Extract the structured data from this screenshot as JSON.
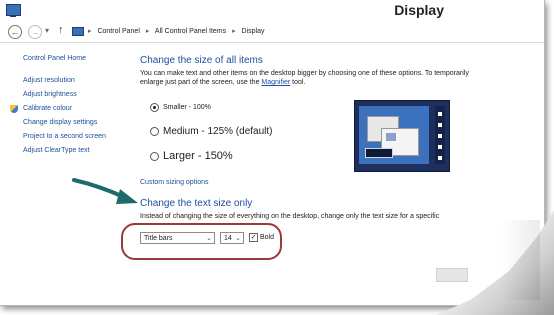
{
  "window": {
    "title": "Display"
  },
  "address": {
    "crumbs": [
      "Control Panel",
      "All Control Panel Items",
      "Display"
    ]
  },
  "sidebar": {
    "home": "Control Panel Home",
    "items": [
      {
        "label": "Adjust resolution"
      },
      {
        "label": "Adjust brightness"
      },
      {
        "label": "Calibrate colour"
      },
      {
        "label": "Change display settings"
      },
      {
        "label": "Project to a second screen"
      },
      {
        "label": "Adjust ClearType text"
      }
    ]
  },
  "main": {
    "heading": "Change the size of all items",
    "description_part1": "You can make text and other items on the desktop bigger by choosing one of these options. To temporarily enlarge just part of the screen, use the",
    "magnifier_link": "Magnifier",
    "description_part2": "tool.",
    "options": [
      {
        "label": "Smaller - 100%",
        "selected": true
      },
      {
        "label": "Medium - 125% (default)",
        "selected": false
      },
      {
        "label": "Larger - 150%",
        "selected": false
      }
    ],
    "custom_sizing": "Custom sizing options",
    "text_heading": "Change the text size only",
    "text_description": "Instead of changing the size of everything on the desktop, change only the text size for a specific",
    "element_select": "Title bars",
    "size_select": "14",
    "bold_label": "Bold",
    "bold_checked": true
  },
  "colors": {
    "link": "#1e4e9c",
    "highlight": "#9b3a3a",
    "arrow": "#1f6b6b"
  }
}
